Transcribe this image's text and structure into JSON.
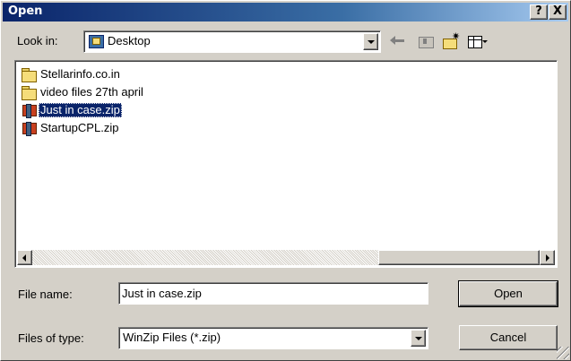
{
  "window": {
    "title": "Open",
    "help_label": "?",
    "close_label": "X"
  },
  "look_in": {
    "label": "Look in:",
    "value": "Desktop"
  },
  "files": [
    {
      "name": "Stellarinfo.co.in",
      "icon": "folder-icon"
    },
    {
      "name": "video files 27th april",
      "icon": "folder-icon"
    },
    {
      "name": "Just in case.zip",
      "icon": "zip-icon",
      "selected": true
    },
    {
      "name": "StartupCPL.zip",
      "icon": "zip-icon"
    }
  ],
  "file_name": {
    "label": "File name:",
    "value": "Just in case.zip"
  },
  "file_type": {
    "label": "Files of type:",
    "value": "WinZip Files (*.zip)"
  },
  "buttons": {
    "open": "Open",
    "cancel": "Cancel"
  },
  "colors": {
    "titlebar": "#0a246a",
    "selection": "#0a246a",
    "face": "#d4d0c8"
  }
}
